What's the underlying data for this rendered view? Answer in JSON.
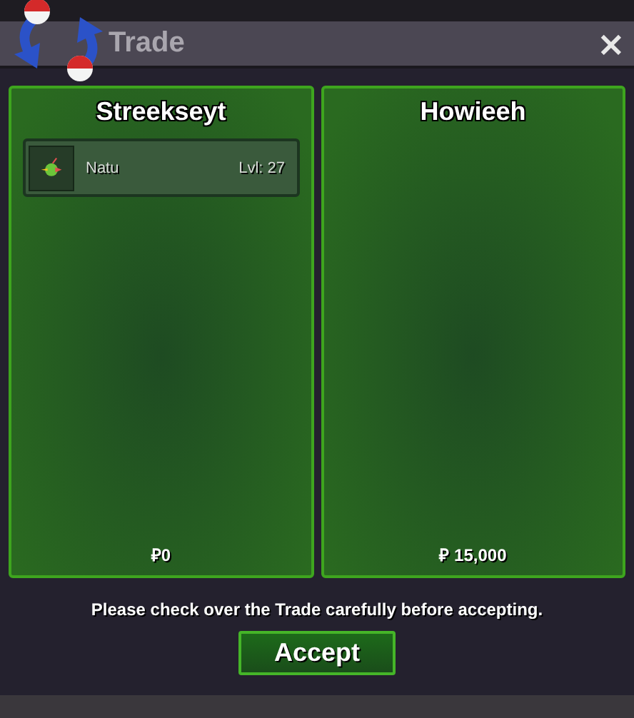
{
  "window": {
    "title": "Trade",
    "close": "×"
  },
  "panels": [
    {
      "name": "Streekseyt",
      "items": [
        {
          "name": "Natu",
          "level": "Lvl: 27"
        }
      ],
      "money": "₽0"
    },
    {
      "name": "Howieeh",
      "money": "₽ 15,000"
    }
  ],
  "notice": "Please check over the Trade carefully before accepting.",
  "accept_button": "Accept"
}
